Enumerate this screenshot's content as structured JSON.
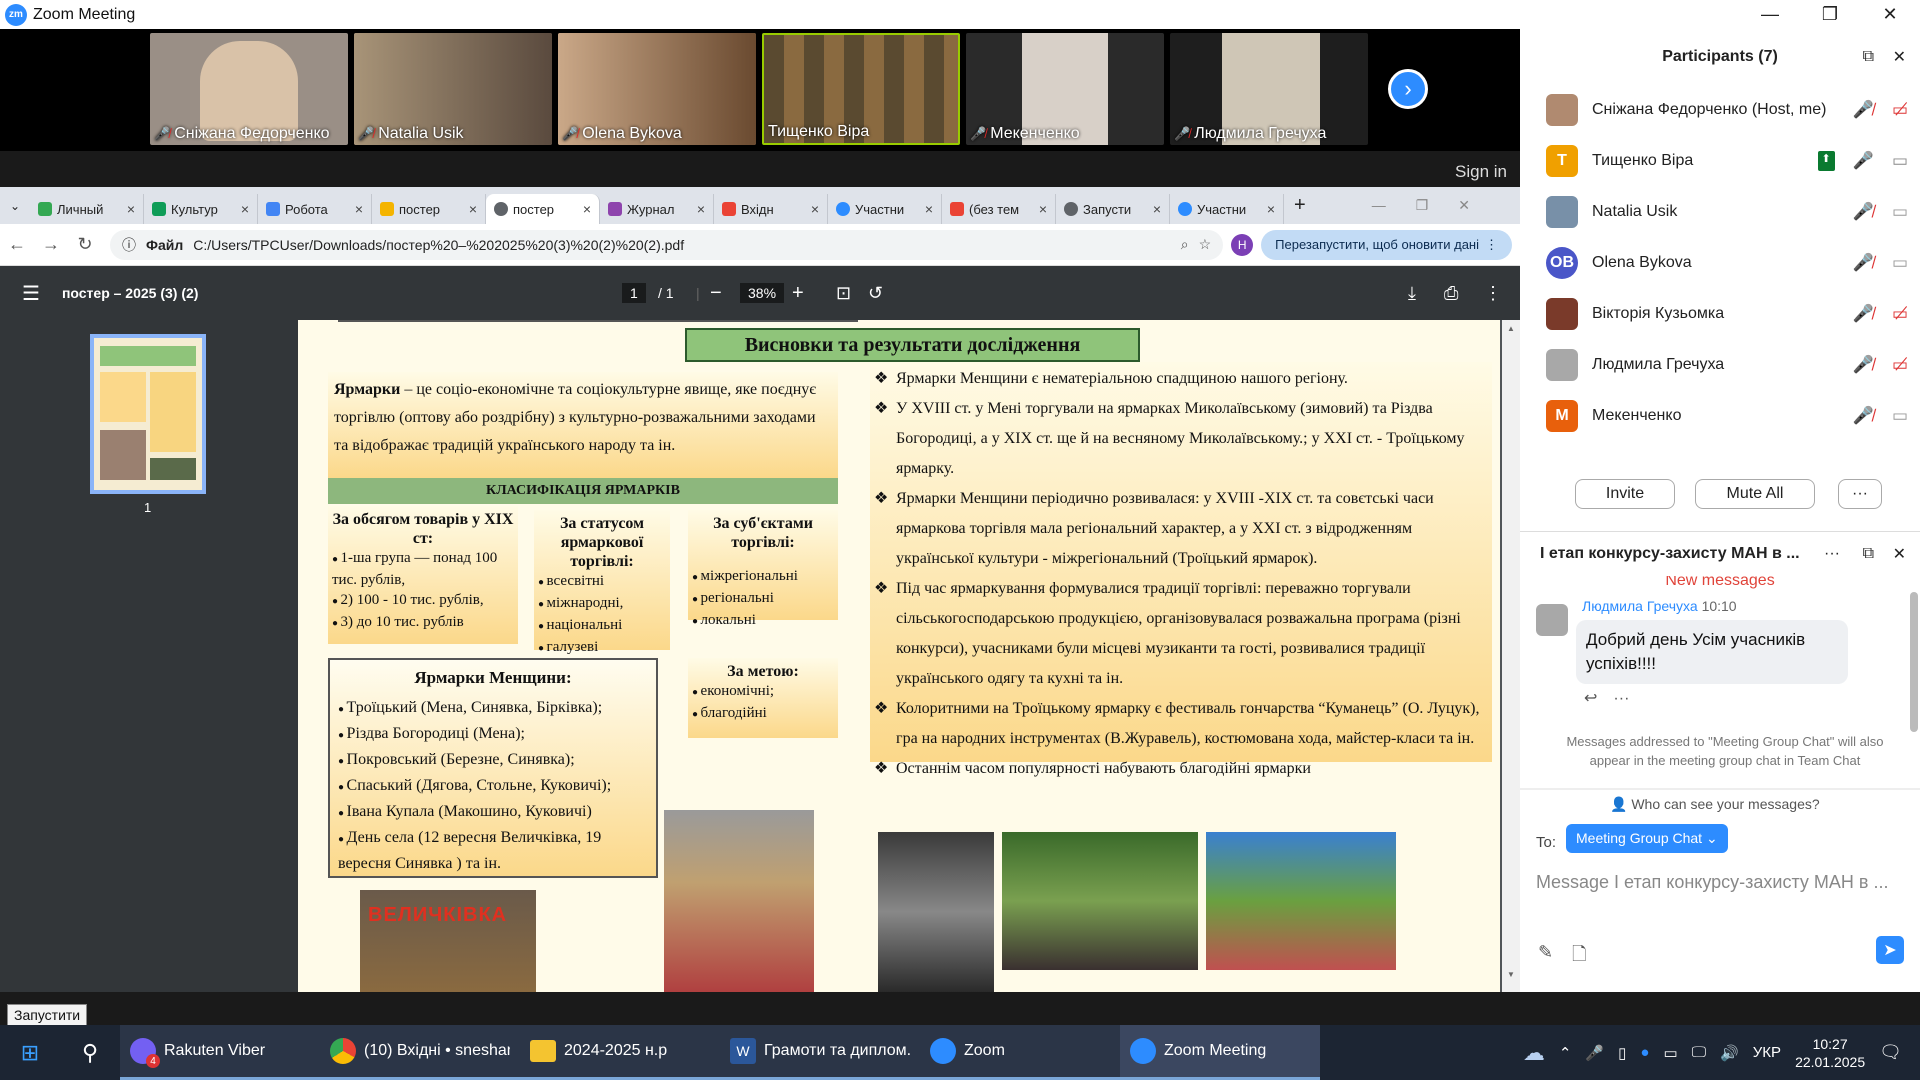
{
  "zoom": {
    "title": "Zoom Meeting",
    "sign_in": "Sign in"
  },
  "videos": [
    {
      "name": "Сніжана Федорченко",
      "bg": "#9a8f86"
    },
    {
      "name": "Natalia Usik",
      "bg": "#8a7a6a"
    },
    {
      "name": "Olena Bykova",
      "bg": "#8b6d55"
    },
    {
      "name": "Тищенко Віра",
      "bg": "#6b6555"
    },
    {
      "name": "Мекенченко",
      "bg": "#2a2a2a"
    },
    {
      "name": "Людмила Гречуха",
      "bg": "#1e1e1e"
    }
  ],
  "browser": {
    "tabs": [
      {
        "label": "Личный",
        "color": "#34a853"
      },
      {
        "label": "Культур",
        "color": "#0f9d58"
      },
      {
        "label": "Робота",
        "color": "#4285f4"
      },
      {
        "label": "постер",
        "color": "#f4b400"
      },
      {
        "label": "постер",
        "color": "#5f6368"
      },
      {
        "label": "Журнал",
        "color": "#8e44ad"
      },
      {
        "label": "Вхідн",
        "color": "#ea4335"
      },
      {
        "label": "Участни",
        "color": "#2d8cff"
      },
      {
        "label": "(без тем",
        "color": "#ea4335"
      },
      {
        "label": "Запусти",
        "color": "#5f6368"
      },
      {
        "label": "Участни",
        "color": "#2d8cff"
      }
    ],
    "file_label": "Файл",
    "url": "C:/Users/TPCUser/Downloads/постер%20–%202025%20(3)%20(2)%20(2).pdf",
    "relaunch": "Перезапустити, щоб оновити дані",
    "profile_letter": "Н"
  },
  "pdf": {
    "title": "постер – 2025 (3) (2)",
    "page_current": "1",
    "page_total": "/ 1",
    "zoom": "38%",
    "thumb_label": "1"
  },
  "poster": {
    "heading": "Висновки та результати дослідження",
    "definition_bold": "Ярмарки",
    "definition_rest": " – це соціо-економічне та соціокультурне явище, яке поєднує торгівлю (оптову або роздрібну) з культурно-розважальними заходами та відображає традицій українського народу та ін.",
    "classification": "КЛАСИФІКАЦІЯ ЯРМАРКІВ",
    "col1_title": "За обсягом товарів у XIX ст:",
    "col1_items": [
      "1-ша група — понад 100 тис. рублів,",
      "2) 100 - 10 тис. рублів,",
      "3)  до 10 тис. рублів"
    ],
    "col2_title": "За статусом ярмаркової торгівлі:",
    "col2_items": [
      "всесвітні",
      "міжнародні,",
      "національні",
      "галузеві"
    ],
    "col3_title": "За суб'єктами торгівлі:",
    "col3_items": [
      "міжрегіональні",
      "регіональні",
      "локальні"
    ],
    "col4_title": "За метою:",
    "col4_items": [
      "економічні;",
      "благодійні"
    ],
    "men_title": "Ярмарки Менщини:",
    "men_items": [
      "Троїцький (Мена, Синявка, Бірківка);",
      "Різдва Богородиці (Мена);",
      "Покровський (Березне, Синявка);",
      "Спаський (Дягова, Стольне, Куковичі);",
      "Івана Купала (Макошино, Куковичі)",
      "День села (12 вересня Величківка, 19 вересня Синявка ) та ін."
    ],
    "right_items": [
      "Ярмарки Менщини є нематеріальною спадщиною нашого регіону.",
      "У XVIII ст. у Мені торгували на ярмарках Миколаївському (зимовий) та Різдва Богородиці, а у XIX ст. ще й на весняному Миколаївському.; у XXI ст.  - Троїцькому ярмарку.",
      "Ярмарки Менщини періодично розвивалася: у XVIII -XIX  ст. та совєтські часи ярмаркова торгівля мала регіональний характер, а у XXI ст. з відродженням української культури - міжрегіональний (Троїцький ярмарок).",
      "Під час ярмаркування формувалися традиції торгівлі: переважно торгували сільськогосподарською продукцією, організовувалася розважальна програма (різні конкурси), учасниками були місцеві музиканти та гості, розвивалися традиції українського одягу та кухні та ін.",
      "Колоритними на Троїцькому ярмарку є фестиваль гончарства “Куманець” (О. Луцук), гра на народних інструментах (В.Журавель), костюмована хода, майстер-класи та ін.",
      "Останнім часом популярності набувають благодійні ярмарки"
    ],
    "sign_text": "ВЕЛИЧКІВКА"
  },
  "participants": {
    "title": "Participants (7)",
    "list": [
      {
        "name": "Сніжана Федорченко (Host, me)",
        "avatar": "",
        "color": "#b08a70"
      },
      {
        "name": "Тищенко Віра",
        "avatar": "T",
        "color": "#f0a000"
      },
      {
        "name": "Natalia Usik",
        "avatar": "",
        "color": "#7890a8"
      },
      {
        "name": "Olena Bykova",
        "avatar": "OB",
        "color": "#4a56c8"
      },
      {
        "name": "Вікторія Кузьомка",
        "avatar": "",
        "color": "#7a3a2a"
      },
      {
        "name": "Людмила Гречуха",
        "avatar": "",
        "color": "#a8a8a8"
      },
      {
        "name": "Мекенченко",
        "avatar": "M",
        "color": "#e8600c"
      }
    ],
    "invite": "Invite",
    "mute_all": "Mute All",
    "more": "···"
  },
  "chat": {
    "title": "І етап конкурсу-захисту МАН в ...",
    "new_messages": "New messages",
    "sender": "Людмила Гречуха",
    "time": "10:10",
    "message": "Добрий день Усім учасників успіхів!!!!",
    "notice": "Messages addressed to \"Meeting Group Chat\" will also appear in the meeting group chat in Team Chat",
    "who_can_see": "Who can see your messages?",
    "to_label": "To:",
    "to_value": "Meeting Group Chat",
    "placeholder": "Message І етап конкурсу-захисту МАН в ..."
  },
  "tooltip": "Запустити",
  "taskbar": {
    "apps": [
      {
        "label": "Rakuten Viber",
        "badge": "4",
        "color": "#7360f2"
      },
      {
        "label": "(10) Вхідні • sneshan...",
        "color": "#4285f4"
      },
      {
        "label": "2024-2025 н.р",
        "color": "#f4c430"
      },
      {
        "label": "Грамоти та диплом...",
        "color": "#2b579a"
      },
      {
        "label": "Zoom",
        "color": "#2d8cff"
      },
      {
        "label": "Zoom Meeting",
        "color": "#2d8cff"
      }
    ],
    "lang": "УКР",
    "time": "10:27",
    "date": "22.01.2025"
  }
}
